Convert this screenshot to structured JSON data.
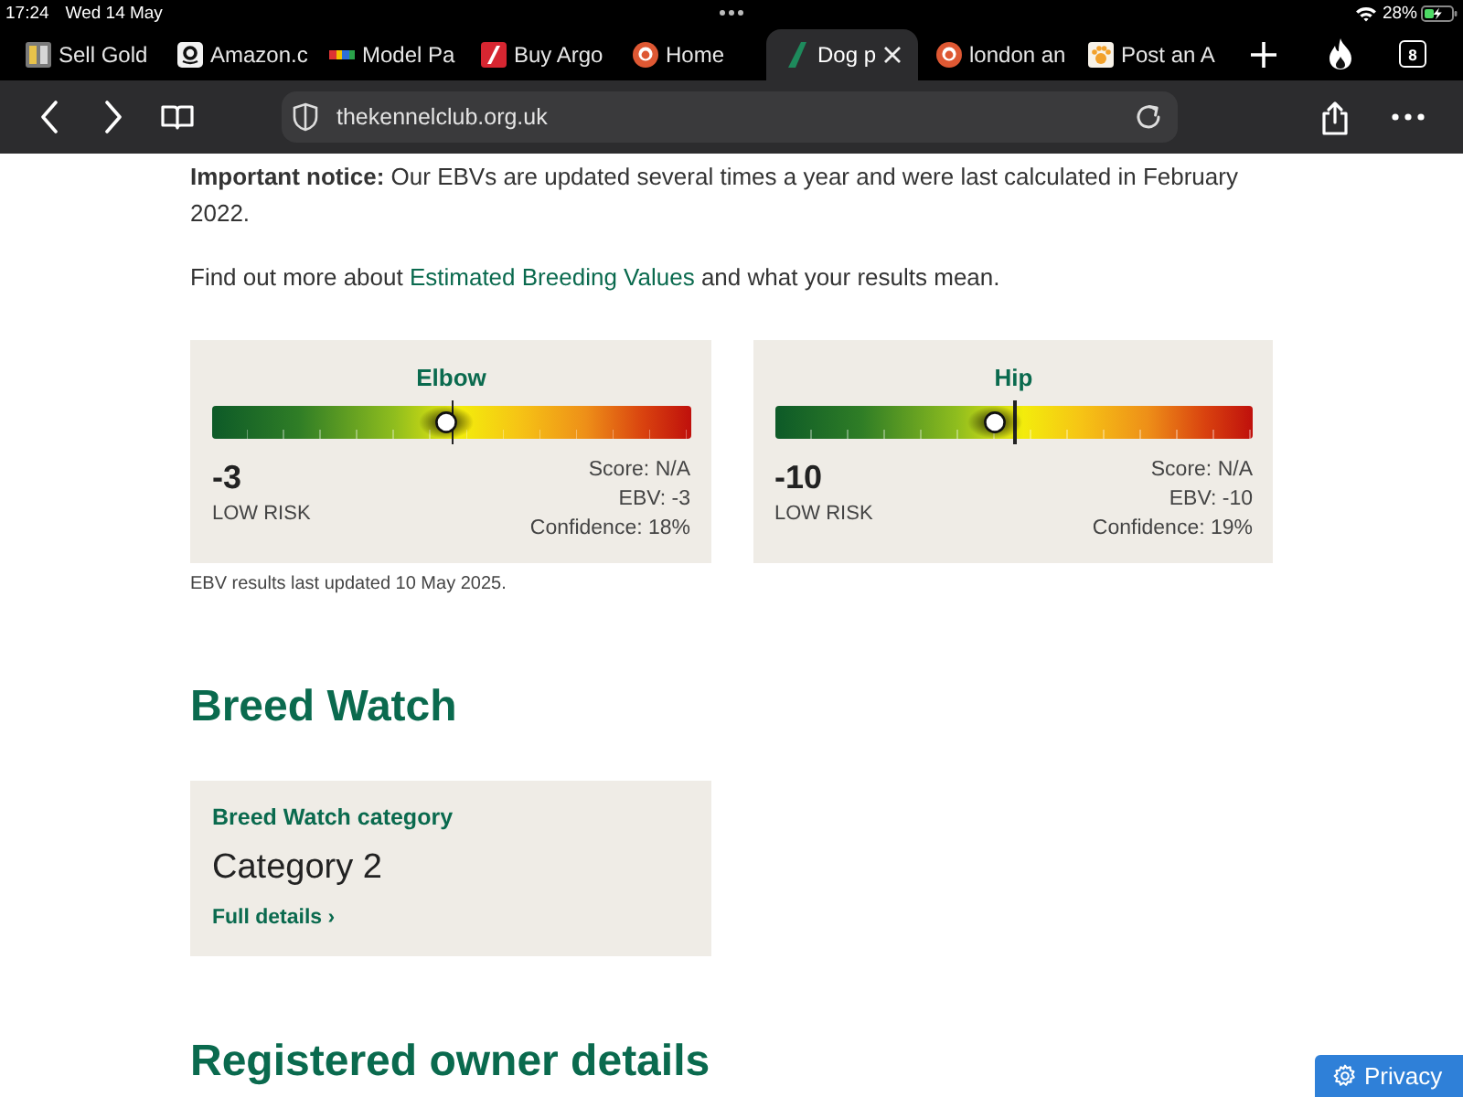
{
  "status_bar": {
    "time": "17:24",
    "date": "Wed 14 May",
    "battery": "28%"
  },
  "tabs": [
    {
      "title": "Sell Gold",
      "kind": "bars",
      "selected": false
    },
    {
      "title": "Amazon.c",
      "kind": "square",
      "selected": false
    },
    {
      "title": "Model Pa",
      "kind": "stripes",
      "selected": false
    },
    {
      "title": "Buy Argo",
      "kind": "slash",
      "selected": false
    },
    {
      "title": "Home",
      "kind": "circle",
      "selected": false
    },
    {
      "title": "Dog p",
      "kind": "leaf",
      "selected": true
    },
    {
      "title": "london an",
      "kind": "circle",
      "selected": false
    },
    {
      "title": "Post an A",
      "kind": "paw",
      "selected": false
    }
  ],
  "tab_count": "8",
  "address_bar": {
    "url": "thekennelclub.org.uk"
  },
  "notice": "**Important notice:** Our EBVs are updated several times a year and were last calculated in February 2022.",
  "more_info": {
    "before": "Find out more about ",
    "link": "Estimated Breeding Values",
    "after": " and what your results mean."
  },
  "ebv_cards": [
    {
      "title": "Elbow",
      "level": 0.49,
      "value": "-3",
      "risk": "LOW RISK",
      "score": "Score: N/A",
      "ebv": "EBV: -3",
      "confidence": "Confidence: 18%"
    },
    {
      "title": "Hip",
      "level": 0.46,
      "value": "-10",
      "risk": "LOW RISK",
      "score": "Score: N/A",
      "ebv": "EBV: -10",
      "confidence": "Confidence: 19%"
    }
  ],
  "ebv_updated": "EBV results last updated 10 May 2025.",
  "breed_watch": {
    "heading": "Breed Watch",
    "card_title": "Breed Watch category",
    "category": "Category 2",
    "link": "Full details ›"
  },
  "owner_heading": "Registered owner details",
  "privacy_button": "Privacy"
}
